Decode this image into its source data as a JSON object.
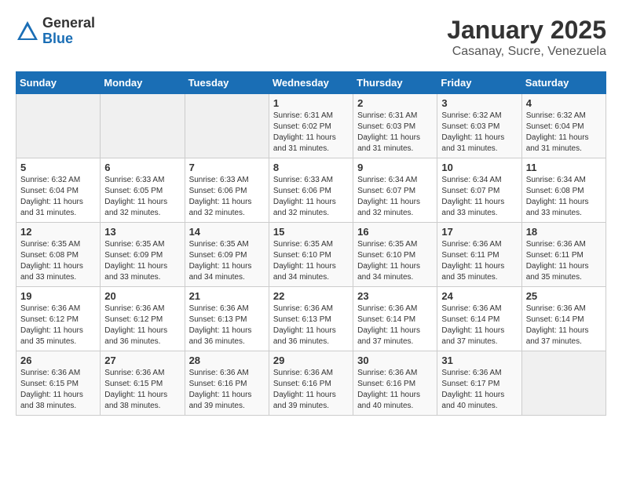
{
  "header": {
    "logo_general": "General",
    "logo_blue": "Blue",
    "month_title": "January 2025",
    "location": "Casanay, Sucre, Venezuela"
  },
  "days_of_week": [
    "Sunday",
    "Monday",
    "Tuesday",
    "Wednesday",
    "Thursday",
    "Friday",
    "Saturday"
  ],
  "weeks": [
    [
      {
        "day": "",
        "info": ""
      },
      {
        "day": "",
        "info": ""
      },
      {
        "day": "",
        "info": ""
      },
      {
        "day": "1",
        "info": "Sunrise: 6:31 AM\nSunset: 6:02 PM\nDaylight: 11 hours and 31 minutes."
      },
      {
        "day": "2",
        "info": "Sunrise: 6:31 AM\nSunset: 6:03 PM\nDaylight: 11 hours and 31 minutes."
      },
      {
        "day": "3",
        "info": "Sunrise: 6:32 AM\nSunset: 6:03 PM\nDaylight: 11 hours and 31 minutes."
      },
      {
        "day": "4",
        "info": "Sunrise: 6:32 AM\nSunset: 6:04 PM\nDaylight: 11 hours and 31 minutes."
      }
    ],
    [
      {
        "day": "5",
        "info": "Sunrise: 6:32 AM\nSunset: 6:04 PM\nDaylight: 11 hours and 31 minutes."
      },
      {
        "day": "6",
        "info": "Sunrise: 6:33 AM\nSunset: 6:05 PM\nDaylight: 11 hours and 32 minutes."
      },
      {
        "day": "7",
        "info": "Sunrise: 6:33 AM\nSunset: 6:06 PM\nDaylight: 11 hours and 32 minutes."
      },
      {
        "day": "8",
        "info": "Sunrise: 6:33 AM\nSunset: 6:06 PM\nDaylight: 11 hours and 32 minutes."
      },
      {
        "day": "9",
        "info": "Sunrise: 6:34 AM\nSunset: 6:07 PM\nDaylight: 11 hours and 32 minutes."
      },
      {
        "day": "10",
        "info": "Sunrise: 6:34 AM\nSunset: 6:07 PM\nDaylight: 11 hours and 33 minutes."
      },
      {
        "day": "11",
        "info": "Sunrise: 6:34 AM\nSunset: 6:08 PM\nDaylight: 11 hours and 33 minutes."
      }
    ],
    [
      {
        "day": "12",
        "info": "Sunrise: 6:35 AM\nSunset: 6:08 PM\nDaylight: 11 hours and 33 minutes."
      },
      {
        "day": "13",
        "info": "Sunrise: 6:35 AM\nSunset: 6:09 PM\nDaylight: 11 hours and 33 minutes."
      },
      {
        "day": "14",
        "info": "Sunrise: 6:35 AM\nSunset: 6:09 PM\nDaylight: 11 hours and 34 minutes."
      },
      {
        "day": "15",
        "info": "Sunrise: 6:35 AM\nSunset: 6:10 PM\nDaylight: 11 hours and 34 minutes."
      },
      {
        "day": "16",
        "info": "Sunrise: 6:35 AM\nSunset: 6:10 PM\nDaylight: 11 hours and 34 minutes."
      },
      {
        "day": "17",
        "info": "Sunrise: 6:36 AM\nSunset: 6:11 PM\nDaylight: 11 hours and 35 minutes."
      },
      {
        "day": "18",
        "info": "Sunrise: 6:36 AM\nSunset: 6:11 PM\nDaylight: 11 hours and 35 minutes."
      }
    ],
    [
      {
        "day": "19",
        "info": "Sunrise: 6:36 AM\nSunset: 6:12 PM\nDaylight: 11 hours and 35 minutes."
      },
      {
        "day": "20",
        "info": "Sunrise: 6:36 AM\nSunset: 6:12 PM\nDaylight: 11 hours and 36 minutes."
      },
      {
        "day": "21",
        "info": "Sunrise: 6:36 AM\nSunset: 6:13 PM\nDaylight: 11 hours and 36 minutes."
      },
      {
        "day": "22",
        "info": "Sunrise: 6:36 AM\nSunset: 6:13 PM\nDaylight: 11 hours and 36 minutes."
      },
      {
        "day": "23",
        "info": "Sunrise: 6:36 AM\nSunset: 6:14 PM\nDaylight: 11 hours and 37 minutes."
      },
      {
        "day": "24",
        "info": "Sunrise: 6:36 AM\nSunset: 6:14 PM\nDaylight: 11 hours and 37 minutes."
      },
      {
        "day": "25",
        "info": "Sunrise: 6:36 AM\nSunset: 6:14 PM\nDaylight: 11 hours and 37 minutes."
      }
    ],
    [
      {
        "day": "26",
        "info": "Sunrise: 6:36 AM\nSunset: 6:15 PM\nDaylight: 11 hours and 38 minutes."
      },
      {
        "day": "27",
        "info": "Sunrise: 6:36 AM\nSunset: 6:15 PM\nDaylight: 11 hours and 38 minutes."
      },
      {
        "day": "28",
        "info": "Sunrise: 6:36 AM\nSunset: 6:16 PM\nDaylight: 11 hours and 39 minutes."
      },
      {
        "day": "29",
        "info": "Sunrise: 6:36 AM\nSunset: 6:16 PM\nDaylight: 11 hours and 39 minutes."
      },
      {
        "day": "30",
        "info": "Sunrise: 6:36 AM\nSunset: 6:16 PM\nDaylight: 11 hours and 40 minutes."
      },
      {
        "day": "31",
        "info": "Sunrise: 6:36 AM\nSunset: 6:17 PM\nDaylight: 11 hours and 40 minutes."
      },
      {
        "day": "",
        "info": ""
      }
    ]
  ]
}
